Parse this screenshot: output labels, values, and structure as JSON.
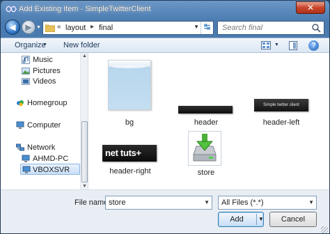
{
  "window": {
    "title": "Add Existing Item - SimpleTwitterClient",
    "close_glyph": "✕"
  },
  "navigation": {
    "back_glyph": "◀",
    "forward_glyph": "▶",
    "path_prefix": "«",
    "path": [
      "layout",
      "final"
    ],
    "path_separator": "▸",
    "refresh_glyph": "↹",
    "search_placeholder": "Search final"
  },
  "toolbar": {
    "organize_label": "Organize",
    "new_folder_label": "New folder",
    "help_glyph": "?"
  },
  "sidebar": {
    "items": [
      {
        "label": "Music",
        "icon": "music-icon"
      },
      {
        "label": "Pictures",
        "icon": "pictures-icon"
      },
      {
        "label": "Videos",
        "icon": "videos-icon"
      },
      {
        "label": "Homegroup",
        "icon": "homegroup-icon"
      },
      {
        "label": "Computer",
        "icon": "computer-icon"
      },
      {
        "label": "Network",
        "icon": "network-icon"
      },
      {
        "label": "AHMD-PC",
        "icon": "computer-icon"
      },
      {
        "label": "VBOXSVR",
        "icon": "computer-icon",
        "selected": true
      }
    ]
  },
  "files": [
    {
      "name": "bg",
      "icon": "image-thumbnail"
    },
    {
      "name": "header",
      "icon": "image-thumbnail"
    },
    {
      "name": "header-left",
      "icon": "image-thumbnail",
      "thumb_text": "Simple twitter client"
    },
    {
      "name": "header-right",
      "icon": "image-thumbnail",
      "thumb_text": "net tuts+"
    },
    {
      "name": "store",
      "icon": "drive-download-icon"
    }
  ],
  "bottom": {
    "file_name_label": "File name:",
    "file_name_value": "store",
    "filter_value": "All Files (*.*)",
    "add_label": "Add",
    "cancel_label": "Cancel"
  },
  "colors": {
    "title_bar": "#4a7bb0",
    "accent": "#3c7fb1",
    "selection": "#c9dff7"
  }
}
